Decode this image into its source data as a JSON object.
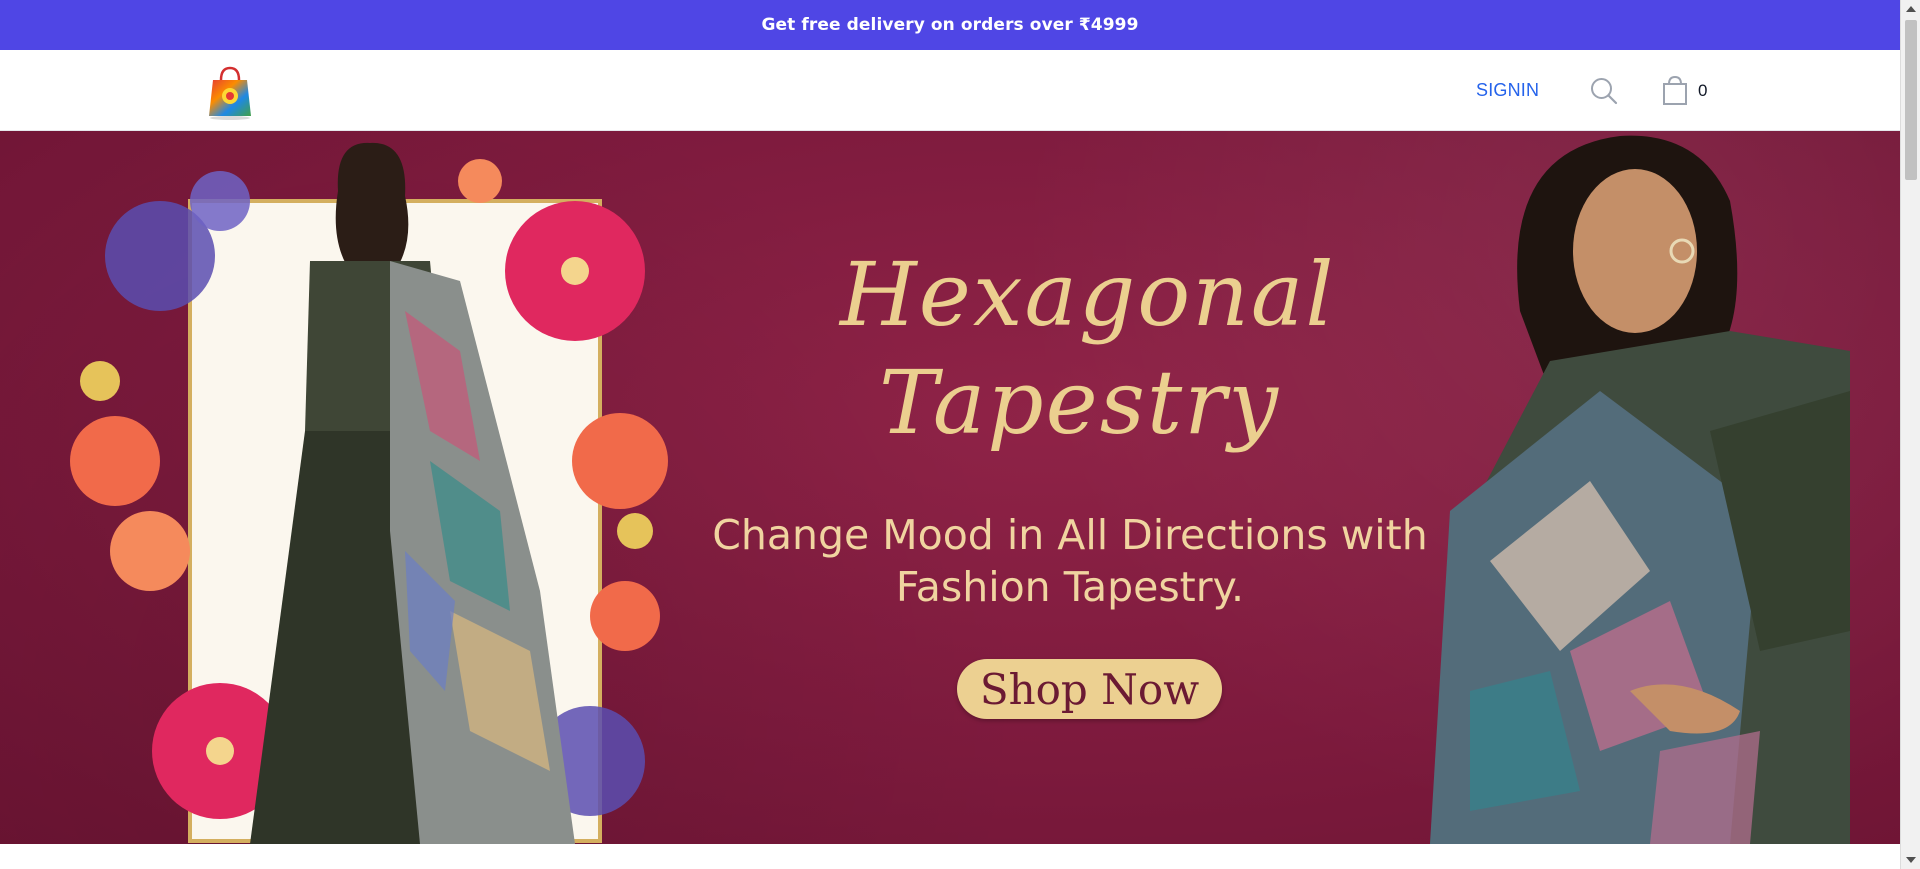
{
  "announcement": {
    "text": "Get free delivery on orders over ₹4999"
  },
  "header": {
    "logo_icon": "shopping-bag-logo",
    "signin_label": "SIGNIN",
    "search_icon": "search-icon",
    "cart_icon": "cart-icon",
    "cart_count": "0"
  },
  "hero": {
    "headline_line1": "Hexagonal",
    "headline_line2": "Tapestry",
    "subline_line1": "Change Mood in All Directions with",
    "subline_line2": "Fashion Tapestry.",
    "cta_label": "Shop Now"
  },
  "colors": {
    "announcement_bg": "#4f46e5",
    "banner_bg": "#7d1a3d",
    "headline_gold": "#ebcf8f",
    "cta_bg": "#ecd091",
    "signin_link": "#2563eb"
  }
}
